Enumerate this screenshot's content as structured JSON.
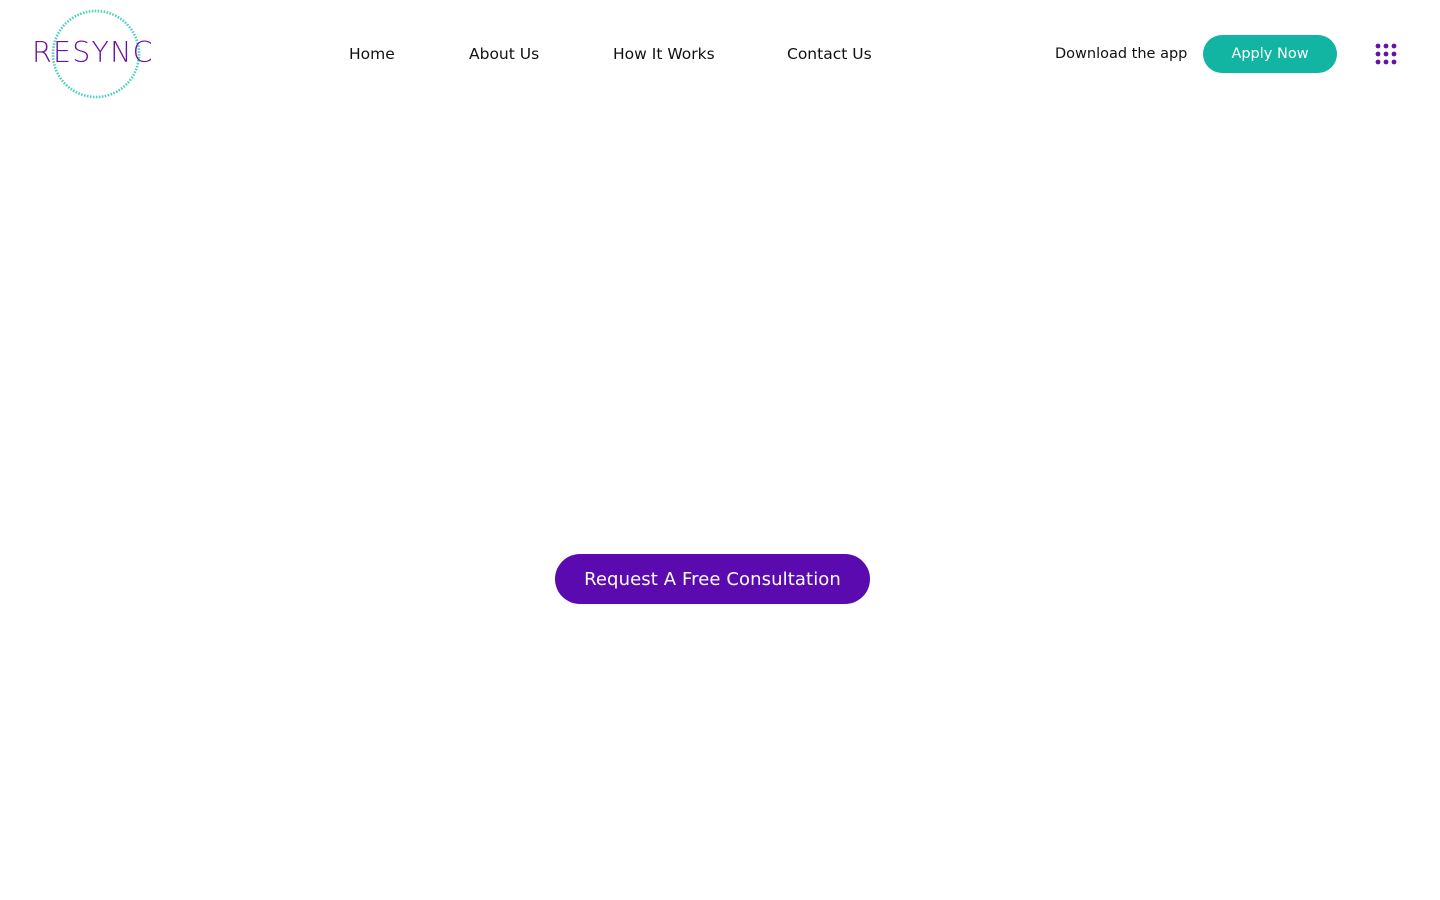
{
  "brand": {
    "name": "RESYNC",
    "primary_color": "#5a0aae",
    "accent_color": "#12b4a2",
    "logo_text_color": "#6512a6"
  },
  "nav": {
    "items": [
      {
        "label": "Home"
      },
      {
        "label": "About Us"
      },
      {
        "label": "How It Works"
      },
      {
        "label": "Contact Us"
      }
    ]
  },
  "header_actions": {
    "download_label": "Download the app",
    "apply_label": "Apply Now",
    "menu_icon": "grid-dots-icon"
  },
  "hero": {
    "cta_label": "Request A Free Consultation"
  }
}
